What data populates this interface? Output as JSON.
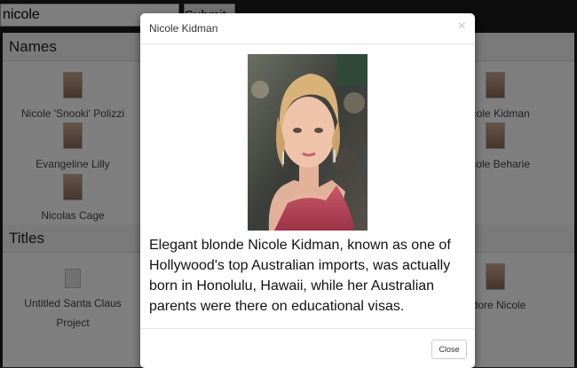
{
  "search": {
    "value": "nicole",
    "submit_label": "Submit"
  },
  "names_section": {
    "title": "Names",
    "items": [
      {
        "label": "Nicole 'Snooki' Polizzi"
      },
      {
        "label": "Evangeline Lilly"
      },
      {
        "label": "Nicolas Cage"
      },
      {
        "label": "Nicole Kidman"
      },
      {
        "label": "Nicole Beharie"
      }
    ]
  },
  "titles_section": {
    "title": "Titles",
    "items": [
      {
        "label": "Untitled Santa Claus Project"
      },
      {
        "label": "Adore Nicole"
      }
    ]
  },
  "modal": {
    "title": "Nicole Kidman",
    "close_x": "×",
    "bio": "Elegant blonde Nicole Kidman, known as one of Hollywood's top Australian imports, was actually born in Honolulu, Hawaii, while her Australian parents were there on educational visas.",
    "close_label": "Close"
  }
}
